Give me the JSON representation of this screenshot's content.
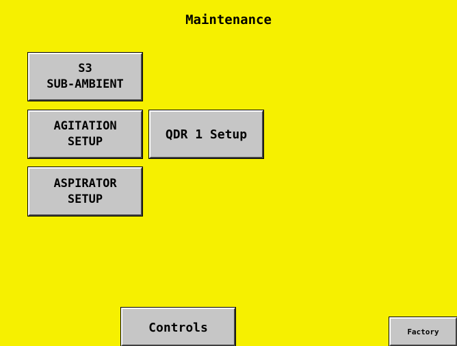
{
  "screen": {
    "title": "Maintenance",
    "background_color": "#f6f000",
    "button_color": "#c6c6c6"
  },
  "buttons": {
    "sub_ambient": {
      "line1": "S3",
      "line2": "SUB-AMBIENT"
    },
    "agitation": {
      "line1": "AGITATION",
      "line2": "SETUP"
    },
    "aspirator": {
      "line1": "ASPIRATOR",
      "line2": "SETUP"
    },
    "qdr": {
      "label": "QDR 1 Setup"
    },
    "controls": {
      "label": "Controls"
    },
    "factory": {
      "label": "Factory"
    }
  }
}
